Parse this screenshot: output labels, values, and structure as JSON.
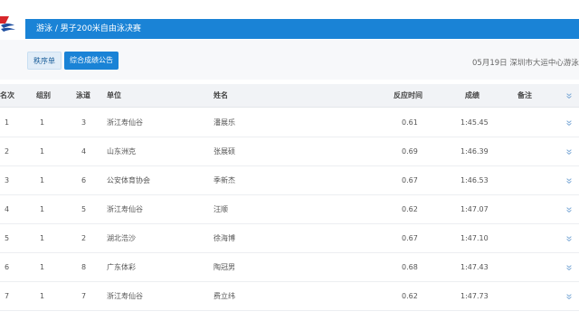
{
  "header": {
    "title": "游泳 / 男子200米自由泳决赛"
  },
  "toolbar": {
    "start_list_label": "秩序单",
    "report_label": "综合成绩公告",
    "meta_text": "05月19日 深圳市大运中心游泳"
  },
  "table": {
    "columns": {
      "rank": "名次",
      "group": "组别",
      "lane": "泳道",
      "unit": "单位",
      "name": "姓名",
      "reaction": "反应时间",
      "result": "成绩",
      "note": "备注"
    },
    "rows": [
      {
        "rank": "1",
        "group": "1",
        "lane": "3",
        "unit": "浙江寿仙谷",
        "name": "潘展乐",
        "reaction": "0.61",
        "result": "1:45.45",
        "note": ""
      },
      {
        "rank": "2",
        "group": "1",
        "lane": "4",
        "unit": "山东洲克",
        "name": "张展硕",
        "reaction": "0.69",
        "result": "1:46.39",
        "note": ""
      },
      {
        "rank": "3",
        "group": "1",
        "lane": "6",
        "unit": "公安体育协会",
        "name": "季新杰",
        "reaction": "0.67",
        "result": "1:46.53",
        "note": ""
      },
      {
        "rank": "4",
        "group": "1",
        "lane": "5",
        "unit": "浙江寿仙谷",
        "name": "汪顺",
        "reaction": "0.62",
        "result": "1:47.07",
        "note": ""
      },
      {
        "rank": "5",
        "group": "1",
        "lane": "2",
        "unit": "湖北浩沙",
        "name": "徐海博",
        "reaction": "0.67",
        "result": "1:47.10",
        "note": ""
      },
      {
        "rank": "6",
        "group": "1",
        "lane": "8",
        "unit": "广东体彩",
        "name": "陶冠男",
        "reaction": "0.68",
        "result": "1:47.43",
        "note": ""
      },
      {
        "rank": "7",
        "group": "1",
        "lane": "7",
        "unit": "浙江寿仙谷",
        "name": "费立纬",
        "reaction": "0.62",
        "result": "1:47.73",
        "note": ""
      }
    ]
  },
  "colors": {
    "accent": "#1a83d6",
    "logo_red": "#d7262b",
    "logo_blue": "#1f4fa0"
  }
}
